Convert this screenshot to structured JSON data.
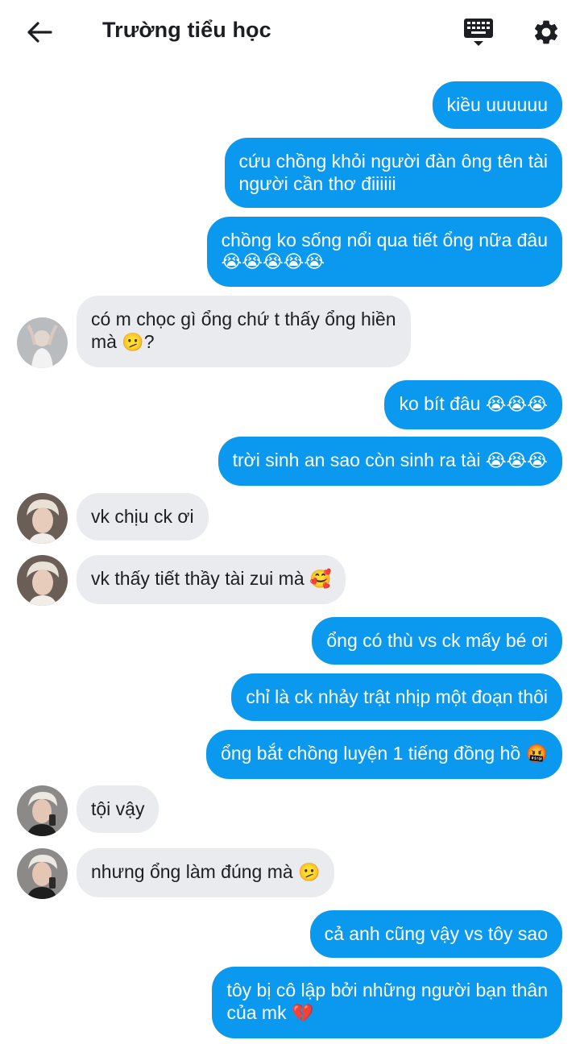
{
  "header": {
    "title": "Trường tiểu học"
  },
  "colors": {
    "outgoing_bubble": "#0a99ee",
    "incoming_bubble": "#e9ebee",
    "icon": "#1c1e21"
  },
  "icons": [
    "arrow-left-icon",
    "keyboard-icon",
    "gear-icon"
  ],
  "messages": [
    {
      "dir": "out",
      "lines": [
        "kiều uuuuuu"
      ],
      "text": "kiều uuuuuu"
    },
    {
      "dir": "out",
      "line1": "cứu chồng khỏi người đàn ông tên tài",
      "line2": "người cần thơ điiiiii"
    },
    {
      "dir": "out",
      "line1": "chồng ko sống nổi qua tiết ổng nữa đâu",
      "emoji": "😭😭😭😭😭"
    },
    {
      "dir": "in",
      "line1": "có m chọc gì ổng chứ t thấy ổng hiền",
      "line2": "mà ",
      "emoji": "🫤",
      "suffix": "?"
    },
    {
      "dir": "out",
      "text": "ko bít đâu ",
      "emoji": "😭😭😭"
    },
    {
      "dir": "out",
      "text": "trời sinh an sao còn sinh ra tài ",
      "emoji": "😭😭😭"
    },
    {
      "dir": "in",
      "text": "vk chịu ck ơi"
    },
    {
      "dir": "in",
      "text": "vk thấy tiết thầy tài zui mà ",
      "emoji": "🥰"
    },
    {
      "dir": "out",
      "text": "ổng có thù vs ck mấy bé ơi"
    },
    {
      "dir": "out",
      "text": "chỉ là ck nhảy trật nhịp một đoạn thôi"
    },
    {
      "dir": "out",
      "text": "ổng bắt chồng luyện 1 tiếng đồng hồ ",
      "emoji": "🤬"
    },
    {
      "dir": "in",
      "text": "tội vậy"
    },
    {
      "dir": "in",
      "text": "nhưng ổng làm đúng mà ",
      "emoji": "🫤"
    },
    {
      "dir": "out",
      "text": "cả anh cũng vậy vs tôy sao"
    },
    {
      "dir": "out",
      "line1": "tôy bị cô lập bởi những người bạn thân",
      "line2": "của mk ",
      "emoji": "💔"
    }
  ]
}
